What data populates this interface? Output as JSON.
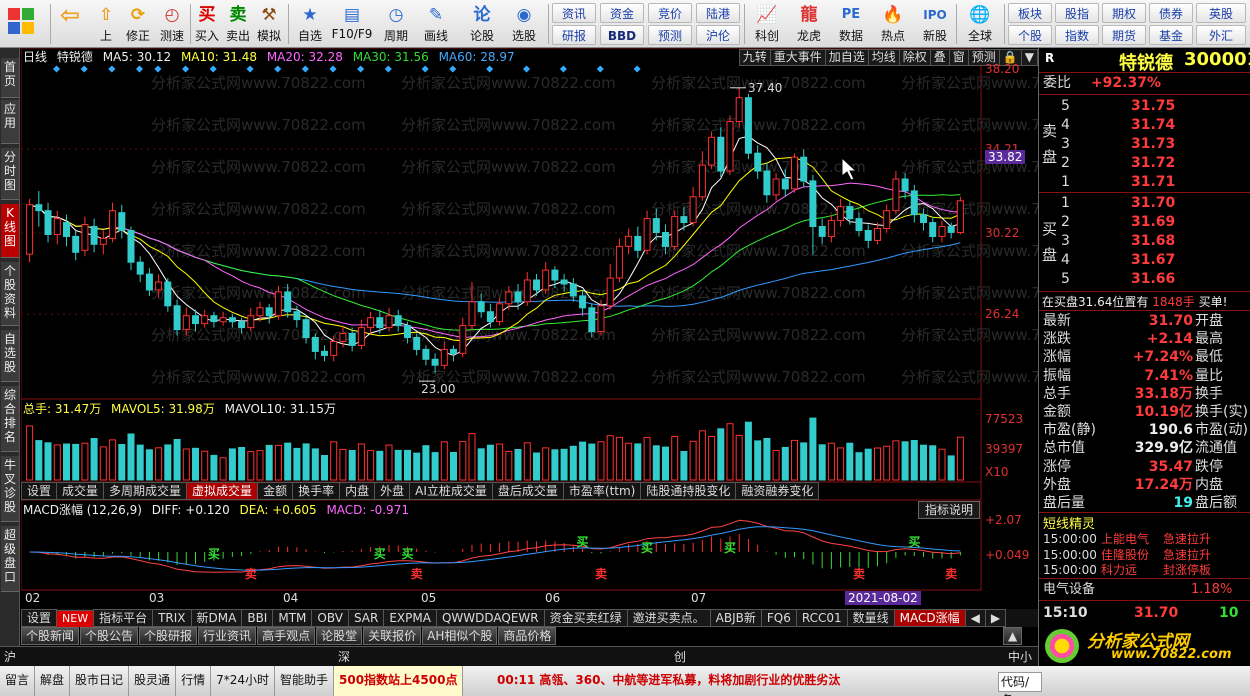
{
  "toolbar": {
    "buttons": [
      {
        "label": "上",
        "icon": "arrow-up-icon"
      },
      {
        "label": "修正",
        "icon": "refresh-icon"
      },
      {
        "label": "测速",
        "icon": "clock-icon"
      },
      {
        "label": "买入",
        "icon": "buy-icon"
      },
      {
        "label": "卖出",
        "icon": "sell-icon"
      },
      {
        "label": "模拟",
        "icon": "hammer-icon"
      },
      {
        "label": "自选",
        "icon": "star-icon"
      },
      {
        "label": "F10/F9",
        "icon": "f10-icon"
      },
      {
        "label": "周期",
        "icon": "period-icon"
      },
      {
        "label": "画线",
        "icon": "pencil-icon"
      },
      {
        "label": "论股",
        "icon": "forum-icon"
      },
      {
        "label": "选股",
        "icon": "gauge-icon"
      }
    ],
    "small_top": [
      "资讯",
      "资金",
      "竞价",
      "陆港"
    ],
    "small_bottom": [
      "研报",
      "BBD",
      "预测",
      "沪伦"
    ],
    "big2": [
      {
        "label": "科创",
        "icon": "chart-icon"
      },
      {
        "label": "龙虎",
        "icon": "dragon-icon"
      },
      {
        "label": "数据",
        "icon": "pe-icon"
      },
      {
        "label": "热点",
        "icon": "hot-icon"
      },
      {
        "label": "新股",
        "icon": "ipo-icon"
      },
      {
        "label": "全球",
        "icon": "globe-icon"
      }
    ],
    "right_top": [
      "板块",
      "股指",
      "期权",
      "债券",
      "英股"
    ],
    "right_bottom": [
      "个股",
      "指数",
      "期货",
      "基金",
      "外汇"
    ]
  },
  "lefttabs": [
    "首页",
    "应用",
    "分时图",
    "K线图",
    "个股资料",
    "自选股",
    "综合排名",
    "牛叉诊股",
    "超级盘口"
  ],
  "chart": {
    "info": {
      "period": "日线",
      "name": "特锐德",
      "ma5": "MA5: 30.12",
      "ma10": "MA10: 31.48",
      "ma20": "MA20: 32.28",
      "ma30": "MA30: 31.56",
      "ma60": "MA60: 28.97"
    },
    "tools": [
      "九转",
      "重大事件",
      "加自选",
      "均线",
      "除权",
      "叠",
      "窗",
      "预测"
    ],
    "price_axis": [
      "38.20",
      "34.21",
      "33.82",
      "30.22",
      "26.24"
    ],
    "high_label": "37.40",
    "low_label": "23.00",
    "watermark": "分析家公式网www.70822.com",
    "vol_info": {
      "total": "总手: 31.47万",
      "mavol5": "MAVOL5: 31.98万",
      "mavol10": "MAVOL10: 31.15万"
    },
    "vol_axis": [
      "77523",
      "39397",
      "X10"
    ],
    "tabs": [
      "设置",
      "成交量",
      "多周期成交量",
      "虚拟成交量",
      "金额",
      "换手率",
      "内盘",
      "外盘",
      "AI立桩成交量",
      "盘后成交量",
      "市盈率(ttm)",
      "陆股通持股变化",
      "融资融券变化"
    ],
    "macd_info": {
      "name": "MACD涨幅 (12,26,9)",
      "diff": "DIFF: +0.120",
      "dea": "DEA: +0.605",
      "macd": "MACD: -0.971"
    },
    "macd_btn": "指标说明",
    "macd_axis": [
      "+2.07",
      "+0.049"
    ],
    "xlabels": [
      "02",
      "03",
      "04",
      "05",
      "06",
      "07"
    ],
    "date_tip": "2021-08-02",
    "signals": {
      "buy": "买",
      "sell": "卖"
    }
  },
  "chart_data": {
    "type": "candlestick",
    "title": "特锐德 日线",
    "ylim": [
      22,
      38.5
    ],
    "ma_colors": {
      "ma5": "#ffffff",
      "ma10": "#ffff00",
      "ma20": "#ff66ff",
      "ma30": "#33ee33",
      "ma60": "#3399ff"
    },
    "candles": [
      [
        29.0,
        31.5,
        28.6,
        31.8
      ],
      [
        31.5,
        31.2,
        30.4,
        32.2
      ],
      [
        31.2,
        30.0,
        29.6,
        31.6
      ],
      [
        30.0,
        30.8,
        29.5,
        31.2
      ],
      [
        30.6,
        29.9,
        29.4,
        31.0
      ],
      [
        29.9,
        29.1,
        28.7,
        30.2
      ],
      [
        29.2,
        30.5,
        28.9,
        30.9
      ],
      [
        30.4,
        29.5,
        29.1,
        30.8
      ],
      [
        29.5,
        29.8,
        29.0,
        30.2
      ],
      [
        29.8,
        31.2,
        29.6,
        31.6
      ],
      [
        31.1,
        30.2,
        29.8,
        31.5
      ],
      [
        30.2,
        28.6,
        28.2,
        30.4
      ],
      [
        28.6,
        28.0,
        27.6,
        28.9
      ],
      [
        28.0,
        27.2,
        26.9,
        28.3
      ],
      [
        27.2,
        27.6,
        26.8,
        28.0
      ],
      [
        27.6,
        26.4,
        26.1,
        27.8
      ],
      [
        26.4,
        25.2,
        24.9,
        26.7
      ],
      [
        25.2,
        25.9,
        24.9,
        26.3
      ],
      [
        25.9,
        25.5,
        25.1,
        26.2
      ],
      [
        25.5,
        25.9,
        25.3,
        26.2
      ],
      [
        25.9,
        25.6,
        25.3,
        26.1
      ],
      [
        25.6,
        25.8,
        25.4,
        26.1
      ],
      [
        25.8,
        25.6,
        25.3,
        26.0
      ],
      [
        25.6,
        25.3,
        25.0,
        25.8
      ],
      [
        25.3,
        25.9,
        25.1,
        26.3
      ],
      [
        25.9,
        26.3,
        25.6,
        26.6
      ],
      [
        26.3,
        25.9,
        25.5,
        26.5
      ],
      [
        25.9,
        27.1,
        25.7,
        27.4
      ],
      [
        27.1,
        26.1,
        25.8,
        27.5
      ],
      [
        26.1,
        25.7,
        25.3,
        26.4
      ],
      [
        25.7,
        24.8,
        24.5,
        25.9
      ],
      [
        24.8,
        24.1,
        23.7,
        25.0
      ],
      [
        24.1,
        23.9,
        23.6,
        24.4
      ],
      [
        23.9,
        24.6,
        23.6,
        24.9
      ],
      [
        24.6,
        25.0,
        24.3,
        25.4
      ],
      [
        25.0,
        24.4,
        24.1,
        25.3
      ],
      [
        24.4,
        25.3,
        24.2,
        25.7
      ],
      [
        25.3,
        25.8,
        25.0,
        26.1
      ],
      [
        25.8,
        25.3,
        25.0,
        26.2
      ],
      [
        25.3,
        25.9,
        25.1,
        26.3
      ],
      [
        25.9,
        25.4,
        25.1,
        26.2
      ],
      [
        25.4,
        24.8,
        24.5,
        25.6
      ],
      [
        24.8,
        24.2,
        23.9,
        25.0
      ],
      [
        24.2,
        23.7,
        23.4,
        24.4
      ],
      [
        23.7,
        23.4,
        23.0,
        24.0
      ],
      [
        23.4,
        24.2,
        23.2,
        24.6
      ],
      [
        24.2,
        24.0,
        23.6,
        24.4
      ],
      [
        24.0,
        25.4,
        23.8,
        25.8
      ],
      [
        25.4,
        26.6,
        25.2,
        27.6
      ],
      [
        26.6,
        26.1,
        25.8,
        27.0
      ],
      [
        26.1,
        25.6,
        25.3,
        26.5
      ],
      [
        25.6,
        26.5,
        25.4,
        26.8
      ],
      [
        26.5,
        27.1,
        26.2,
        27.4
      ],
      [
        27.1,
        26.6,
        26.2,
        27.5
      ],
      [
        26.6,
        27.7,
        26.4,
        28.1
      ],
      [
        27.7,
        27.2,
        26.9,
        28.0
      ],
      [
        27.2,
        28.2,
        27.0,
        28.6
      ],
      [
        28.2,
        27.7,
        27.3,
        28.4
      ],
      [
        27.7,
        27.5,
        27.1,
        28.0
      ],
      [
        27.5,
        26.9,
        26.6,
        27.8
      ],
      [
        26.9,
        26.3,
        25.9,
        27.2
      ],
      [
        26.3,
        25.1,
        24.8,
        26.5
      ],
      [
        25.1,
        26.4,
        24.9,
        26.7
      ],
      [
        26.4,
        27.8,
        26.2,
        28.5
      ],
      [
        27.8,
        29.4,
        27.6,
        29.8
      ],
      [
        29.4,
        29.9,
        29.0,
        30.3
      ],
      [
        29.9,
        29.2,
        28.8,
        30.4
      ],
      [
        29.2,
        30.8,
        29.0,
        31.2
      ],
      [
        30.8,
        30.1,
        29.7,
        31.3
      ],
      [
        30.1,
        29.4,
        29.0,
        30.5
      ],
      [
        29.4,
        30.9,
        29.2,
        31.2
      ],
      [
        30.9,
        30.6,
        30.2,
        31.4
      ],
      [
        30.6,
        31.9,
        30.4,
        32.4
      ],
      [
        31.9,
        33.5,
        31.7,
        34.2
      ],
      [
        33.5,
        34.9,
        33.3,
        35.2
      ],
      [
        34.9,
        33.2,
        32.9,
        35.4
      ],
      [
        33.2,
        35.7,
        33.0,
        36.0
      ],
      [
        35.7,
        36.9,
        35.4,
        37.4
      ],
      [
        36.9,
        34.1,
        33.8,
        37.1
      ],
      [
        34.1,
        33.2,
        32.8,
        34.5
      ],
      [
        33.2,
        32.0,
        31.6,
        33.6
      ],
      [
        32.0,
        32.8,
        31.7,
        33.1
      ],
      [
        32.8,
        32.3,
        31.9,
        33.3
      ],
      [
        32.3,
        33.9,
        32.1,
        34.1
      ],
      [
        33.9,
        32.7,
        32.4,
        34.3
      ],
      [
        32.7,
        30.4,
        29.0,
        33.0
      ],
      [
        30.4,
        29.9,
        29.5,
        30.8
      ],
      [
        29.9,
        30.7,
        29.6,
        31.0
      ],
      [
        30.7,
        31.4,
        30.4,
        31.8
      ],
      [
        31.4,
        30.8,
        30.5,
        31.7
      ],
      [
        30.8,
        30.2,
        29.9,
        31.1
      ],
      [
        30.2,
        29.7,
        29.3,
        30.5
      ],
      [
        29.7,
        30.3,
        29.5,
        30.6
      ],
      [
        30.3,
        31.2,
        30.1,
        31.5
      ],
      [
        31.2,
        32.8,
        31.0,
        33.2
      ],
      [
        32.8,
        32.2,
        31.8,
        33.1
      ],
      [
        32.2,
        31.0,
        30.6,
        32.5
      ],
      [
        31.0,
        30.6,
        30.2,
        31.3
      ],
      [
        30.6,
        29.9,
        29.6,
        30.9
      ],
      [
        29.9,
        30.4,
        29.6,
        30.7
      ],
      [
        30.4,
        30.1,
        29.8,
        30.6
      ],
      [
        30.1,
        31.7,
        30.0,
        31.9
      ]
    ],
    "volume_max": 77523,
    "volume_unit": "X10",
    "macd": {
      "diff": 0.12,
      "dea": 0.605,
      "macd": -0.971
    }
  },
  "right_panel": {
    "stock_name": "特锐德",
    "code": "300001",
    "r_label": "R",
    "weibi_label": "委比",
    "weibi": "+92.37%",
    "sell_label": "卖盘",
    "buy_label": "买盘",
    "sell": [
      {
        "n": "5",
        "p": "31.75"
      },
      {
        "n": "4",
        "p": "31.74"
      },
      {
        "n": "3",
        "p": "31.73"
      },
      {
        "n": "2",
        "p": "31.72"
      },
      {
        "n": "1",
        "p": "31.71"
      }
    ],
    "buy": [
      {
        "n": "1",
        "p": "31.70"
      },
      {
        "n": "2",
        "p": "31.69"
      },
      {
        "n": "3",
        "p": "31.68"
      },
      {
        "n": "4",
        "p": "31.67"
      },
      {
        "n": "5",
        "p": "31.66"
      }
    ],
    "note": "在买盘31.64位置有",
    "note_qty": "1848手",
    "note_tail": "买单!",
    "quotes": [
      {
        "l": "最新",
        "v": "31.70",
        "r": "开盘"
      },
      {
        "l": "涨跌",
        "v": "+2.14",
        "r": "最高"
      },
      {
        "l": "涨幅",
        "v": "+7.24%",
        "r": "最低"
      },
      {
        "l": "振幅",
        "v": "7.41%",
        "r": "量比"
      },
      {
        "l": "总手",
        "v": "33.18万",
        "r": "换手"
      },
      {
        "l": "金额",
        "v": "10.19亿",
        "r": "换手(实)"
      },
      {
        "l": "市盈(静)",
        "v": "190.6",
        "r": "市盈(动)"
      },
      {
        "l": "总市值",
        "v": "329.9亿",
        "r": "流通值"
      },
      {
        "l": "涨停",
        "v": "35.47",
        "r": "跌停"
      },
      {
        "l": "外盘",
        "v": "17.24万",
        "r": "内盘"
      },
      {
        "l": "盘后量",
        "v": "19",
        "r": "盘后额"
      }
    ],
    "shortline_title": "短线精灵",
    "shortline": [
      {
        "t": "15:00:00",
        "a": "上能电气",
        "b": "急速拉升"
      },
      {
        "t": "15:00:00",
        "a": "佳隆股份",
        "b": "急速拉升"
      },
      {
        "t": "15:00:00",
        "a": "科力远",
        "b": "封涨停板"
      }
    ],
    "sector_name": "电气设备",
    "sector_pct": "1.18%",
    "time": "15:10",
    "last_price": "31.70",
    "last_vol": "10",
    "logo_text": "分析家公式网",
    "logo_url": "www.70822.com"
  },
  "bottom": {
    "indicators": [
      "设置",
      "NEW",
      "指标平台",
      "TRIX",
      "新DMA",
      "BBI",
      "MTM",
      "OBV",
      "SAR",
      "EXPMA",
      "QWWDDAQEWR",
      "资金买卖红绿",
      "邀进买卖点。",
      "ABJB新",
      "FQ6",
      "RCC01",
      "数量线",
      "MACD涨幅"
    ],
    "info": [
      "个股新闻",
      "个股公告",
      "个股研报",
      "行业资讯",
      "高手观点",
      "论股堂",
      "关联报价",
      "AH相似个股",
      "商品价格"
    ],
    "index": [
      "沪",
      "深",
      "创",
      "中小"
    ],
    "status": [
      "留言",
      "解盘",
      "股市日记",
      "股灵通",
      "行情",
      "7*24小时",
      "智能助手"
    ],
    "marquee_left": "500指数站上4500点",
    "marquee": "00:11 高瓴、360、中航等进军私募，料将加剧行业的优胜劣汰",
    "code_label": "代码/名"
  }
}
